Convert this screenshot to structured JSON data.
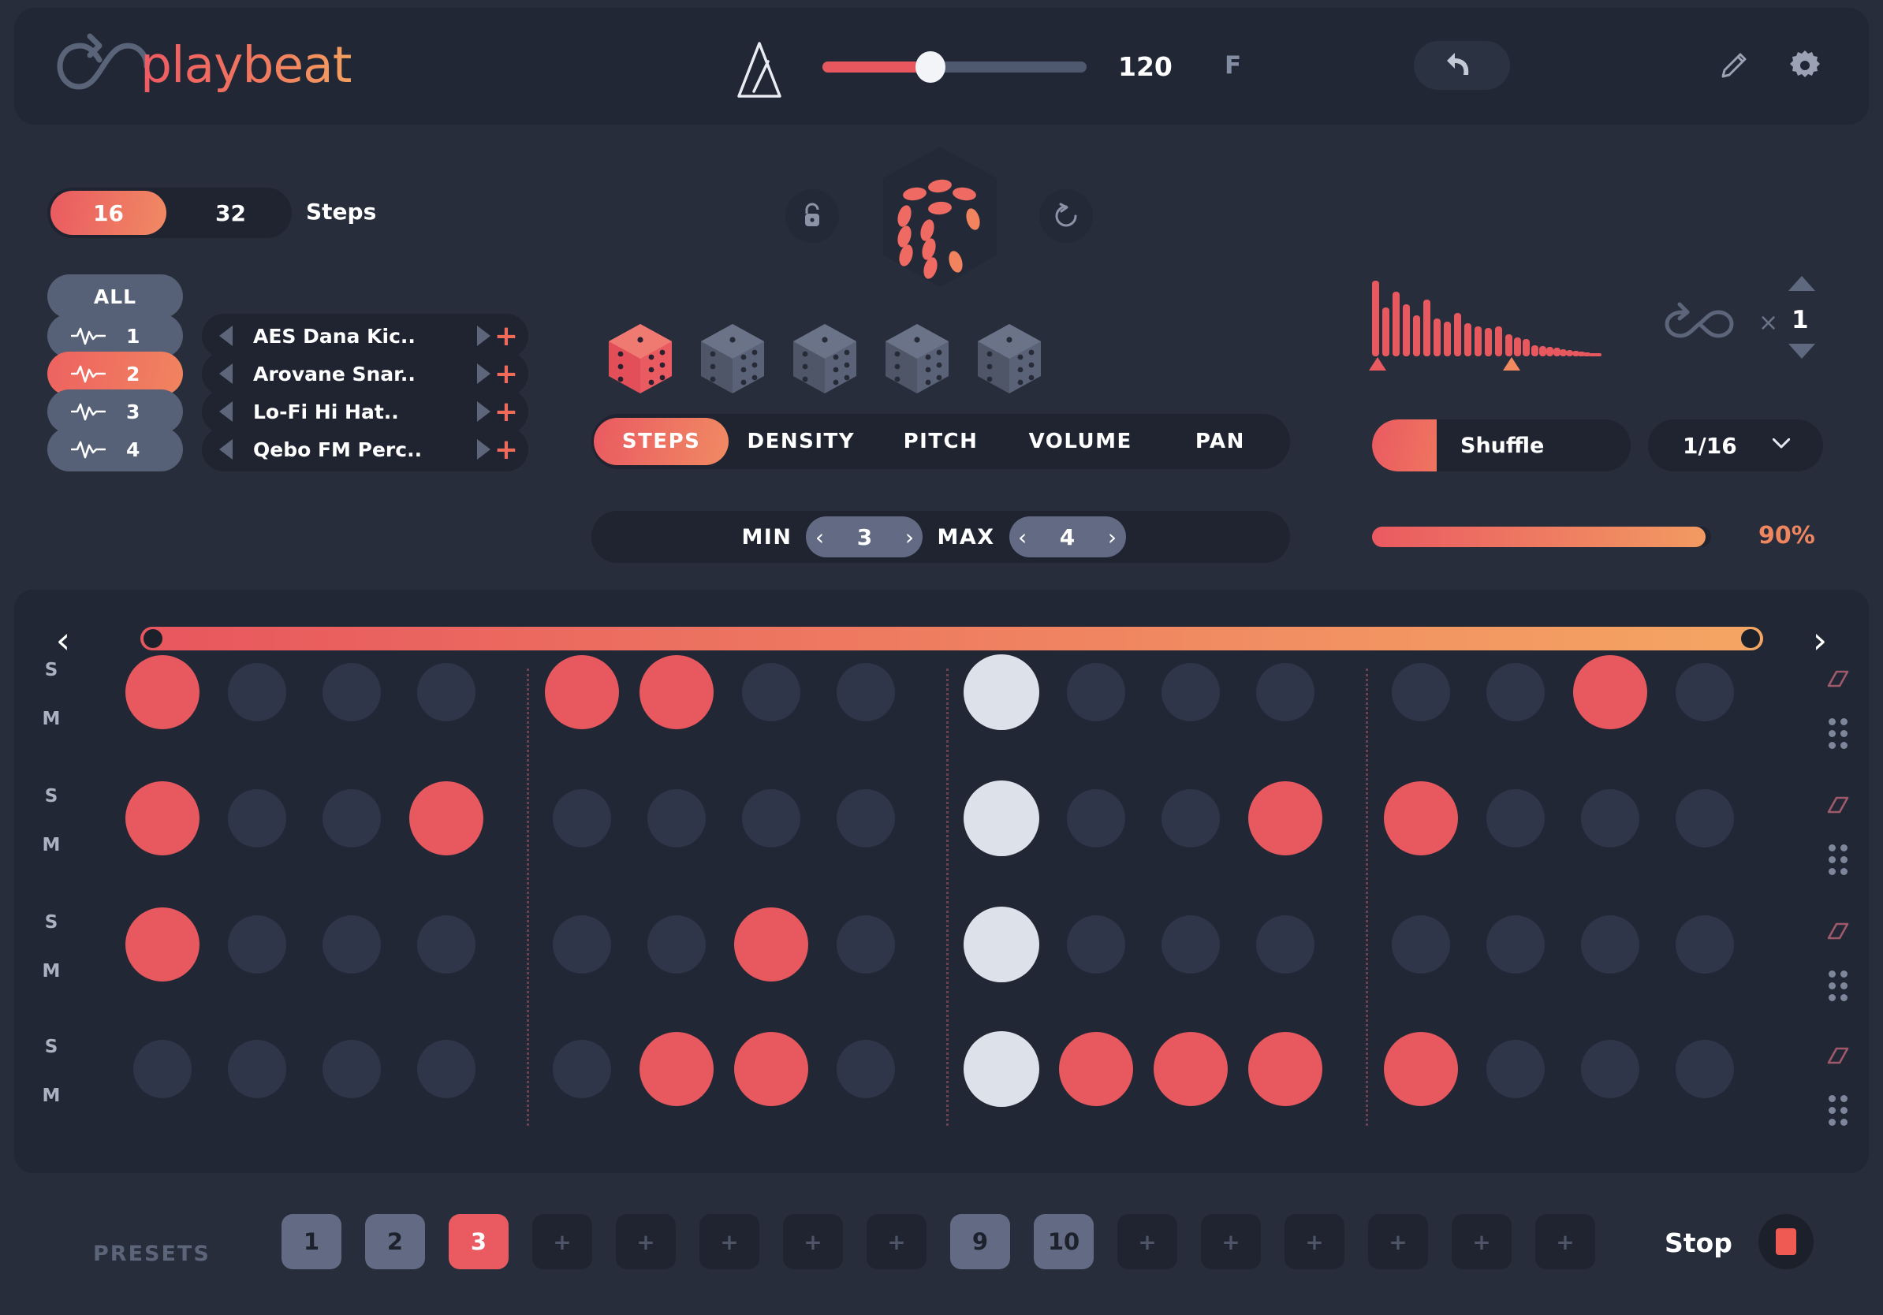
{
  "app": {
    "name": "playbeat"
  },
  "topbar": {
    "metronome_icon": "metronome-icon",
    "tempo": {
      "value": "120",
      "unit": "F",
      "percent": 40
    },
    "undo_icon": "undo-icon",
    "pencil_icon": "pencil-icon",
    "gear_icon": "gear-icon"
  },
  "steps_toggle": {
    "options": [
      "16",
      "32"
    ],
    "selected": "16",
    "label": "Steps"
  },
  "tracks": {
    "all_label": "ALL",
    "items": [
      {
        "num": "1",
        "name": "AES Dana Kic..",
        "active": false
      },
      {
        "num": "2",
        "name": "Arovane Snar..",
        "active": true
      },
      {
        "num": "3",
        "name": "Lo-Fi Hi Hat..",
        "active": false
      },
      {
        "num": "4",
        "name": "Qebo FM Perc..",
        "active": false
      }
    ]
  },
  "randomizer": {
    "lock_icon": "lock-icon",
    "reset_icon": "reset-icon",
    "main_dice_icon": "dice-icon",
    "dice_row": [
      {
        "name": "dice-steps",
        "active": true
      },
      {
        "name": "dice-density",
        "active": false
      },
      {
        "name": "dice-pitch",
        "active": false
      },
      {
        "name": "dice-volume",
        "active": false
      },
      {
        "name": "dice-pan",
        "active": false
      }
    ]
  },
  "tabs": {
    "items": [
      "STEPS",
      "DENSITY",
      "PITCH",
      "VOLUME",
      "PAN"
    ],
    "selected": "STEPS"
  },
  "minmax": {
    "min_label": "MIN",
    "min_value": "3",
    "max_label": "MAX",
    "max_value": "4",
    "prev_icon": "chevron-left-icon",
    "next_icon": "chevron-right-icon"
  },
  "envelope": {
    "loop_icon": "loop-infinity-icon",
    "times_symbol": "×",
    "multiplier": "1",
    "up_icon": "triangle-up-icon",
    "down_icon": "triangle-down-icon"
  },
  "shuffle": {
    "label": "Shuffle",
    "percent": 25,
    "rate": "1/16",
    "rate_chevron_icon": "chevron-down-icon",
    "amount_label": "90%",
    "amount_percent": 90
  },
  "sequencer": {
    "prev_icon": "chevron-left-icon",
    "next_icon": "chevron-right-icon",
    "solo_label": "S",
    "mute_label": "M",
    "eraser_icon": "eraser-icon",
    "drag_icon": "drag-dots-icon",
    "steps_per_row": 16,
    "rows": [
      {
        "track": "1",
        "steps": [
          "on",
          "off",
          "off",
          "off",
          "on",
          "on",
          "off",
          "off",
          "accent",
          "off",
          "off",
          "off",
          "off",
          "off",
          "on",
          "off"
        ]
      },
      {
        "track": "2",
        "steps": [
          "on",
          "off",
          "off",
          "on",
          "off",
          "off",
          "off",
          "off",
          "accent",
          "off",
          "off",
          "on",
          "on",
          "off",
          "off",
          "off"
        ]
      },
      {
        "track": "3",
        "steps": [
          "on",
          "off",
          "off",
          "off",
          "off",
          "off",
          "on",
          "off",
          "accent",
          "off",
          "off",
          "off",
          "off",
          "off",
          "off",
          "off"
        ]
      },
      {
        "track": "4",
        "steps": [
          "off",
          "off",
          "off",
          "off",
          "off",
          "on",
          "on",
          "off",
          "accent",
          "on",
          "on",
          "on",
          "on",
          "off",
          "off",
          "off"
        ]
      }
    ]
  },
  "presets": {
    "label": "PRESETS",
    "slots": [
      {
        "label": "1",
        "state": "filled"
      },
      {
        "label": "2",
        "state": "filled"
      },
      {
        "label": "3",
        "state": "active"
      },
      {
        "label": "+",
        "state": "empty"
      },
      {
        "label": "+",
        "state": "empty"
      },
      {
        "label": "+",
        "state": "empty"
      },
      {
        "label": "+",
        "state": "empty"
      },
      {
        "label": "+",
        "state": "empty"
      },
      {
        "label": "9",
        "state": "filled"
      },
      {
        "label": "10",
        "state": "filled"
      },
      {
        "label": "+",
        "state": "empty"
      },
      {
        "label": "+",
        "state": "empty"
      },
      {
        "label": "+",
        "state": "empty"
      },
      {
        "label": "+",
        "state": "empty"
      },
      {
        "label": "+",
        "state": "empty"
      },
      {
        "label": "+",
        "state": "empty"
      }
    ],
    "stop_label": "Stop",
    "stop_icon": "stop-square-icon"
  },
  "colors": {
    "bg": "#272d3b",
    "panel": "#212734",
    "accent_red": "#e8585f",
    "accent_orange": "#f4a05f",
    "pad_off": "#2f3649",
    "pad_accent": "#dde1ea"
  }
}
